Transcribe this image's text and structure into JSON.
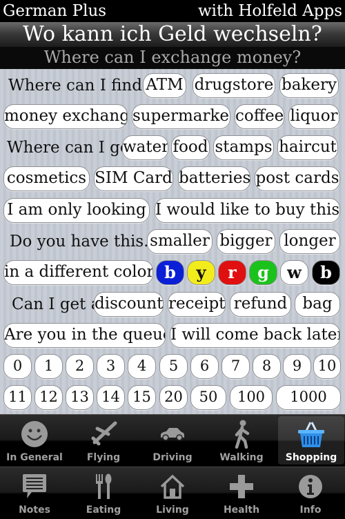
{
  "header": {
    "app_name": "German Plus",
    "publisher": "with Holfeld Apps",
    "title_german": "Wo kann ich Geld wechseln?",
    "title_english": "Where can I exchange money?"
  },
  "phrases": {
    "where_can_i_find": "Where can I find...",
    "where_can_i_get": "Where can I get",
    "do_you_have_this": "Do you have this...",
    "can_i_get_a": "Can I get a"
  },
  "buttons": {
    "atm": "ATM",
    "drugstore": "drugstore",
    "bakery": "bakery",
    "money_exchange": "money exchange",
    "supermarket": "supermarket",
    "coffee": "coffee",
    "liquor": "liquor",
    "water": "water",
    "food": "food",
    "stamps": "stamps",
    "haircut": "haircut",
    "cosmetics": "cosmetics",
    "sim_card": "SIM Card",
    "batteries": "batteries",
    "post_cards": "post cards",
    "only_looking": "I am only looking",
    "buy_this": "I would like to buy this",
    "smaller": "smaller",
    "bigger": "bigger",
    "longer": "longer",
    "different_color": "in a different color?",
    "discount": "discount",
    "receipt": "receipt",
    "refund": "refund",
    "bag": "bag",
    "queue": "Are you in the queue",
    "come_back": "I will come back later"
  },
  "colors": [
    {
      "label": "b",
      "name": "blue",
      "bg": "#0a1fd6",
      "fg": "#ffffff"
    },
    {
      "label": "y",
      "name": "yellow",
      "bg": "#f2ec1c",
      "fg": "#111111"
    },
    {
      "label": "r",
      "name": "red",
      "bg": "#e01010",
      "fg": "#ffffff"
    },
    {
      "label": "g",
      "name": "green",
      "bg": "#1cc21c",
      "fg": "#ffffff"
    },
    {
      "label": "w",
      "name": "white",
      "bg": "#ffffff",
      "fg": "#111111"
    },
    {
      "label": "b",
      "name": "black",
      "bg": "#000000",
      "fg": "#ffffff"
    }
  ],
  "numbers_row1": [
    "0",
    "1",
    "2",
    "3",
    "4",
    "5",
    "6",
    "7",
    "8",
    "9",
    "10"
  ],
  "numbers_row2": [
    "11",
    "12",
    "13",
    "14",
    "15",
    "20",
    "50",
    "100",
    "1000"
  ],
  "tabs_top": [
    {
      "label": "In General",
      "icon": "smiley-icon",
      "selected": false
    },
    {
      "label": "Flying",
      "icon": "airplane-icon",
      "selected": false
    },
    {
      "label": "Driving",
      "icon": "car-icon",
      "selected": false
    },
    {
      "label": "Walking",
      "icon": "walking-person-icon",
      "selected": false
    },
    {
      "label": "Shopping",
      "icon": "shopping-basket-icon",
      "selected": true
    }
  ],
  "tabs_bottom": [
    {
      "label": "Notes",
      "icon": "speech-bubble-icon"
    },
    {
      "label": "Eating",
      "icon": "fork-spoon-icon"
    },
    {
      "label": "Living",
      "icon": "house-icon"
    },
    {
      "label": "Health",
      "icon": "cross-icon"
    },
    {
      "label": "Info",
      "icon": "info-icon"
    }
  ],
  "theme": {
    "accent_selected_icon": "#3aa0f0",
    "tab_text": "#a0a0a0"
  }
}
